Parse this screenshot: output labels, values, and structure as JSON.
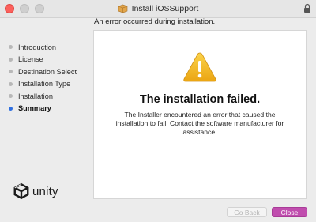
{
  "window": {
    "title": "Install iOSSupport",
    "header_message": "An error occurred during installation."
  },
  "sidebar": {
    "steps": [
      {
        "label": "Introduction",
        "active": false
      },
      {
        "label": "License",
        "active": false
      },
      {
        "label": "Destination Select",
        "active": false
      },
      {
        "label": "Installation Type",
        "active": false
      },
      {
        "label": "Installation",
        "active": false
      },
      {
        "label": "Summary",
        "active": true
      }
    ],
    "brand": "unity"
  },
  "main": {
    "heading": "The installation failed.",
    "detail": "The Installer encountered an error that caused the installation to fail. Contact the software manufacturer for assistance.",
    "icon": "warning-icon"
  },
  "buttons": {
    "back_label": "Go Back",
    "back_enabled": false,
    "close_label": "Close"
  },
  "colors": {
    "accent": "#c04dae",
    "active_step": "#2f6fe0",
    "warning": "#f3b51c"
  }
}
